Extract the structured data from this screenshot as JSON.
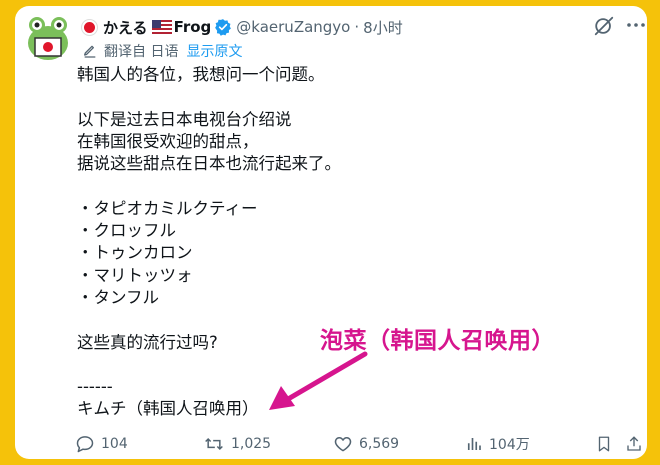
{
  "tweet": {
    "display_name": "かえる",
    "name_suffix": "Frog",
    "handle": "@kaeruZangyo",
    "separator": "·",
    "time": "8小时",
    "translate_label": "翻译自 日语",
    "show_original_label": "显示原文",
    "body_lines": [
      "韩国人的各位，我想问一个问题。",
      "",
      "以下是过去日本电视台介绍说",
      "在韩国很受欢迎的甜点，",
      "据说这些甜点在日本也流行起来了。",
      "",
      "・タピオカミルクティー",
      "・クロッフル",
      "・トゥンカロン",
      "・マリトッツォ",
      "・タンフル",
      "",
      "这些真的流行过吗?",
      "",
      "------",
      "キムチ（韩国人召唤用）"
    ]
  },
  "annotation": {
    "text": "泡菜（韩国人召唤用）",
    "color": "#d6158e"
  },
  "actions": {
    "replies": "104",
    "retweets": "1,025",
    "likes": "6,569",
    "views": "104万"
  },
  "icons": [
    "jp-flag-avatar-icon",
    "verified-badge-icon",
    "us-flag-icon",
    "grok-icon",
    "more-icon",
    "translate-icon",
    "reply-icon",
    "retweet-icon",
    "like-icon",
    "views-icon",
    "bookmark-icon",
    "share-icon"
  ],
  "colors": {
    "background": "#f5c20a",
    "link": "#1d9bf0",
    "verified": "#1d9bf0",
    "text": "#0f1419",
    "muted": "#536471"
  }
}
